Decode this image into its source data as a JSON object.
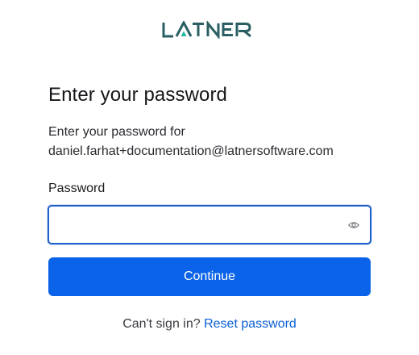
{
  "brand": {
    "logo_text": "LATNER",
    "logo_color": "#2b5f63",
    "logo_accent": "#1fb5a0"
  },
  "page": {
    "title": "Enter your password",
    "description_line1": "Enter your password for",
    "email": "daniel.farhat+documentation@latnersoftware.com"
  },
  "form": {
    "password_label": "Password",
    "password_value": "",
    "toggle_icon": "eye-icon",
    "continue_label": "Continue"
  },
  "footer": {
    "prompt": "Can't sign in?",
    "reset_link": "Reset password"
  },
  "colors": {
    "primary": "#0a63e8",
    "link": "#0b5fd6",
    "focus_border": "#1f5fc9"
  }
}
